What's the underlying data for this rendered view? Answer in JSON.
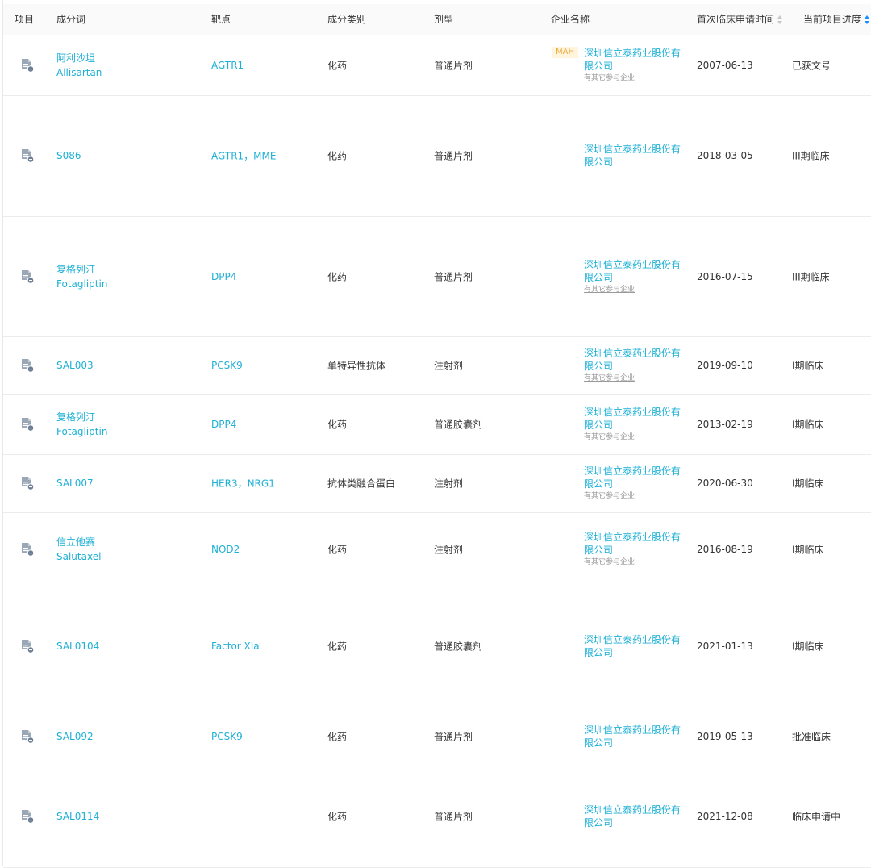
{
  "columns": {
    "project": "项目",
    "ingredient": "成分词",
    "target": "靶点",
    "category": "成分类别",
    "dosage_form": "剂型",
    "company": "企业名称",
    "first_clinical_date": "首次临床申请时间",
    "current_stage": "当前项目进度"
  },
  "sort_state": {
    "first_clinical_date": "none",
    "current_stage": "active"
  },
  "colors": {
    "link": "#1eb0d6",
    "badge_bg": "#fff4dc",
    "badge_text": "#f0a73a",
    "sort_active": "#1890ff"
  },
  "rows": [
    {
      "icon": "document-icon",
      "name": "阿利沙坦",
      "name_en": "Allisartan",
      "target": "AGTR1",
      "category": "化药",
      "form": "普通片剂",
      "badge": "MAH",
      "company_l1": "深圳信立泰药业股份有",
      "company_l2": "限公司",
      "other": "有其它参与企业",
      "date": "2007-06-13",
      "stage": "已获文号"
    },
    {
      "icon": "document-icon",
      "name": "S086",
      "name_en": "",
      "target": "AGTR1，MME",
      "category": "化药",
      "form": "普通片剂",
      "badge": "",
      "company_l1": "深圳信立泰药业股份有",
      "company_l2": "限公司",
      "other": "",
      "date": "2018-03-05",
      "stage": "III期临床"
    },
    {
      "icon": "document-icon",
      "name": "复格列汀",
      "name_en": "Fotagliptin",
      "target": "DPP4",
      "category": "化药",
      "form": "普通片剂",
      "badge": "",
      "company_l1": "深圳信立泰药业股份有",
      "company_l2": "限公司",
      "other": "有其它参与企业",
      "date": "2016-07-15",
      "stage": "III期临床"
    },
    {
      "icon": "document-icon",
      "name": "SAL003",
      "name_en": "",
      "target": "PCSK9",
      "category": "单特异性抗体",
      "form": "注射剂",
      "badge": "",
      "company_l1": "深圳信立泰药业股份有",
      "company_l2": "限公司",
      "other": "有其它参与企业",
      "date": "2019-09-10",
      "stage": "I期临床"
    },
    {
      "icon": "document-icon",
      "name": "复格列汀",
      "name_en": "Fotagliptin",
      "target": "DPP4",
      "category": "化药",
      "form": "普通胶囊剂",
      "badge": "",
      "company_l1": "深圳信立泰药业股份有",
      "company_l2": "限公司",
      "other": "有其它参与企业",
      "date": "2013-02-19",
      "stage": "I期临床"
    },
    {
      "icon": "document-icon",
      "name": "SAL007",
      "name_en": "",
      "target": "HER3，NRG1",
      "category": "抗体类融合蛋白",
      "form": "注射剂",
      "badge": "",
      "company_l1": "深圳信立泰药业股份有",
      "company_l2": "限公司",
      "other": "有其它参与企业",
      "date": "2020-06-30",
      "stage": "I期临床"
    },
    {
      "icon": "document-icon",
      "name": "信立他赛",
      "name_en": "Salutaxel",
      "target": "NOD2",
      "category": "化药",
      "form": "注射剂",
      "badge": "",
      "company_l1": "深圳信立泰药业股份有",
      "company_l2": "限公司",
      "other": "有其它参与企业",
      "date": "2016-08-19",
      "stage": "I期临床"
    },
    {
      "icon": "document-icon",
      "name": "SAL0104",
      "name_en": "",
      "target": "Factor XIa",
      "category": "化药",
      "form": "普通胶囊剂",
      "badge": "",
      "company_l1": "深圳信立泰药业股份有",
      "company_l2": "限公司",
      "other": "",
      "date": "2021-01-13",
      "stage": "I期临床"
    },
    {
      "icon": "document-icon",
      "name": "SAL092",
      "name_en": "",
      "target": "PCSK9",
      "category": "化药",
      "form": "普通片剂",
      "badge": "",
      "company_l1": "深圳信立泰药业股份有",
      "company_l2": "限公司",
      "other": "",
      "date": "2019-05-13",
      "stage": "批准临床"
    },
    {
      "icon": "document-icon",
      "name": "SAL0114",
      "name_en": "",
      "target": "",
      "category": "化药",
      "form": "普通片剂",
      "badge": "",
      "company_l1": "深圳信立泰药业股份有",
      "company_l2": "限公司",
      "other": "",
      "date": "2021-12-08",
      "stage": "临床申请中"
    }
  ]
}
